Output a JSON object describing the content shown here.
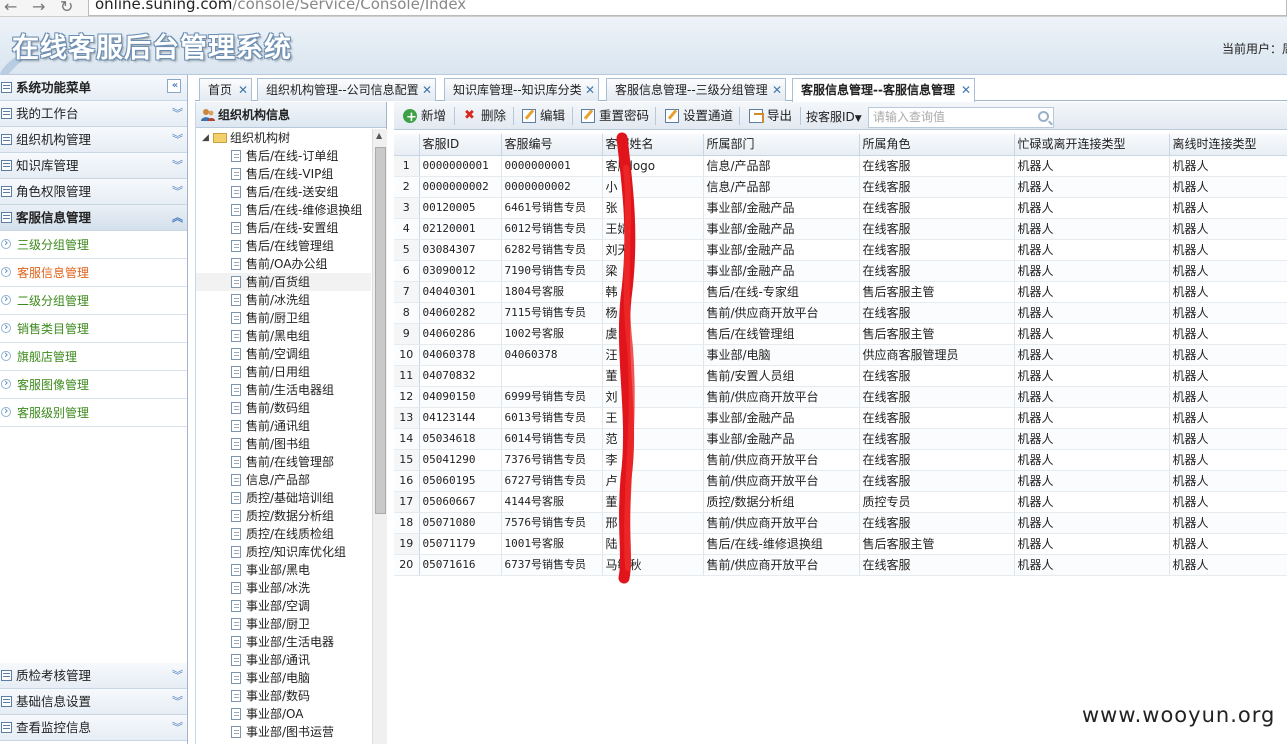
{
  "browser": {
    "url_host": "online.suning.com",
    "url_path": "/console/Service/Console/Index"
  },
  "header": {
    "title": "在线客服后台管理系统",
    "current_user_label": "当前用户：周"
  },
  "left_menu": {
    "title": "系统功能菜单",
    "sections_top": [
      {
        "label": "我的工作台"
      },
      {
        "label": "组织机构管理"
      },
      {
        "label": "知识库管理"
      },
      {
        "label": "角色权限管理"
      }
    ],
    "open_section": {
      "label": "客服信息管理",
      "items": [
        {
          "label": "三级分组管理",
          "active": false
        },
        {
          "label": "客服信息管理",
          "active": true
        },
        {
          "label": "二级分组管理",
          "active": false
        },
        {
          "label": "销售类目管理",
          "active": false
        },
        {
          "label": "旗舰店管理",
          "active": false
        },
        {
          "label": "客服图像管理",
          "active": false
        },
        {
          "label": "客服级别管理",
          "active": false
        }
      ]
    },
    "sections_bottom": [
      {
        "label": "质检考核管理"
      },
      {
        "label": "基础信息设置"
      },
      {
        "label": "查看监控信息"
      }
    ]
  },
  "tabs": [
    {
      "label": "首页"
    },
    {
      "label": "组织机构管理--公司信息配置"
    },
    {
      "label": "知识库管理--知识库分类"
    },
    {
      "label": "客服信息管理--三级分组管理"
    },
    {
      "label": "客服信息管理--客服信息管理"
    }
  ],
  "tree_panel": {
    "title": "组织机构信息",
    "root": "组织机构树",
    "nodes": [
      "售后/在线-订单组",
      "售后/在线-VIP组",
      "售后/在线-送安组",
      "售后/在线-维修退换组",
      "售后/在线-安置组",
      "售后/在线管理组",
      "售前/OA办公组",
      "售前/百货组",
      "售前/冰洗组",
      "售前/厨卫组",
      "售前/黑电组",
      "售前/空调组",
      "售前/日用组",
      "售前/生活电器组",
      "售前/数码组",
      "售前/通讯组",
      "售前/图书组",
      "售前/在线管理部",
      "信息/产品部",
      "质控/基础培训组",
      "质控/数据分析组",
      "质控/在线质检组",
      "质控/知识库优化组",
      "事业部/黑电",
      "事业部/冰洗",
      "事业部/空调",
      "事业部/厨卫",
      "事业部/生活电器",
      "事业部/通讯",
      "事业部/电脑",
      "事业部/数码",
      "事业部/OA",
      "事业部/图书运营"
    ]
  },
  "toolbar": {
    "add": "新增",
    "delete": "删除",
    "edit": "编辑",
    "reset_password": "重置密码",
    "set_channel": "设置通道",
    "export": "导出",
    "search_field": "按客服ID",
    "search_placeholder": "请输入查询值"
  },
  "table": {
    "columns": [
      "客服ID",
      "客服编号",
      "客服姓名",
      "所属部门",
      "所属角色",
      "忙碌或离开连接类型",
      "离线时连接类型"
    ],
    "rows": [
      [
        "0000000001",
        "0000000001",
        "客服logo",
        "信息/产品部",
        "在线客服",
        "机器人",
        "机器人"
      ],
      [
        "0000000002",
        "0000000002",
        "小",
        "信息/产品部",
        "在线客服",
        "机器人",
        "机器人"
      ],
      [
        "00120005",
        "6461号销售专员",
        "张",
        "事业部/金融产品",
        "在线客服",
        "机器人",
        "机器人"
      ],
      [
        "02120001",
        "6012号销售专员",
        "王婧",
        "事业部/金融产品",
        "在线客服",
        "机器人",
        "机器人"
      ],
      [
        "03084307",
        "6282号销售专员",
        "刘天",
        "事业部/金融产品",
        "在线客服",
        "机器人",
        "机器人"
      ],
      [
        "03090012",
        "7190号销售专员",
        "梁",
        "事业部/金融产品",
        "在线客服",
        "机器人",
        "机器人"
      ],
      [
        "04040301",
        "1804号客服",
        "韩",
        "售后/在线-专家组",
        "售后客服主管",
        "机器人",
        "机器人"
      ],
      [
        "04060282",
        "7115号销售专员",
        "杨",
        "售前/供应商开放平台",
        "在线客服",
        "机器人",
        "机器人"
      ],
      [
        "04060286",
        "1002号客服",
        "虞",
        "售后/在线管理组",
        "售后客服主管",
        "机器人",
        "机器人"
      ],
      [
        "04060378",
        "04060378",
        "汪",
        "事业部/电脑",
        "供应商客服管理员",
        "机器人",
        "机器人"
      ],
      [
        "04070832",
        "",
        "董",
        "售前/安置人员组",
        "在线客服",
        "机器人",
        "机器人"
      ],
      [
        "04090150",
        "6999号销售专员",
        "刘",
        "售前/供应商开放平台",
        "在线客服",
        "机器人",
        "机器人"
      ],
      [
        "04123144",
        "6013号销售专员",
        "王",
        "事业部/金融产品",
        "在线客服",
        "机器人",
        "机器人"
      ],
      [
        "05034618",
        "6014号销售专员",
        "范",
        "事业部/金融产品",
        "在线客服",
        "机器人",
        "机器人"
      ],
      [
        "05041290",
        "7376号销售专员",
        "李",
        "售前/供应商开放平台",
        "在线客服",
        "机器人",
        "机器人"
      ],
      [
        "05060195",
        "6727号销售专员",
        "卢",
        "售前/供应商开放平台",
        "在线客服",
        "机器人",
        "机器人"
      ],
      [
        "05060667",
        "4144号客服",
        "董",
        "质控/数据分析组",
        "质控专员",
        "机器人",
        "机器人"
      ],
      [
        "05071080",
        "7576号销售专员",
        "邢",
        "售前/供应商开放平台",
        "在线客服",
        "机器人",
        "机器人"
      ],
      [
        "05071179",
        "1001号客服",
        "陆",
        "售后/在线-维修退换组",
        "售后客服主管",
        "机器人",
        "机器人"
      ],
      [
        "05071616",
        "6737号销售专员",
        "马敏秋",
        "售前/供应商开放平台",
        "在线客服",
        "机器人",
        "机器人"
      ]
    ]
  },
  "watermark": "www.wooyun.org"
}
